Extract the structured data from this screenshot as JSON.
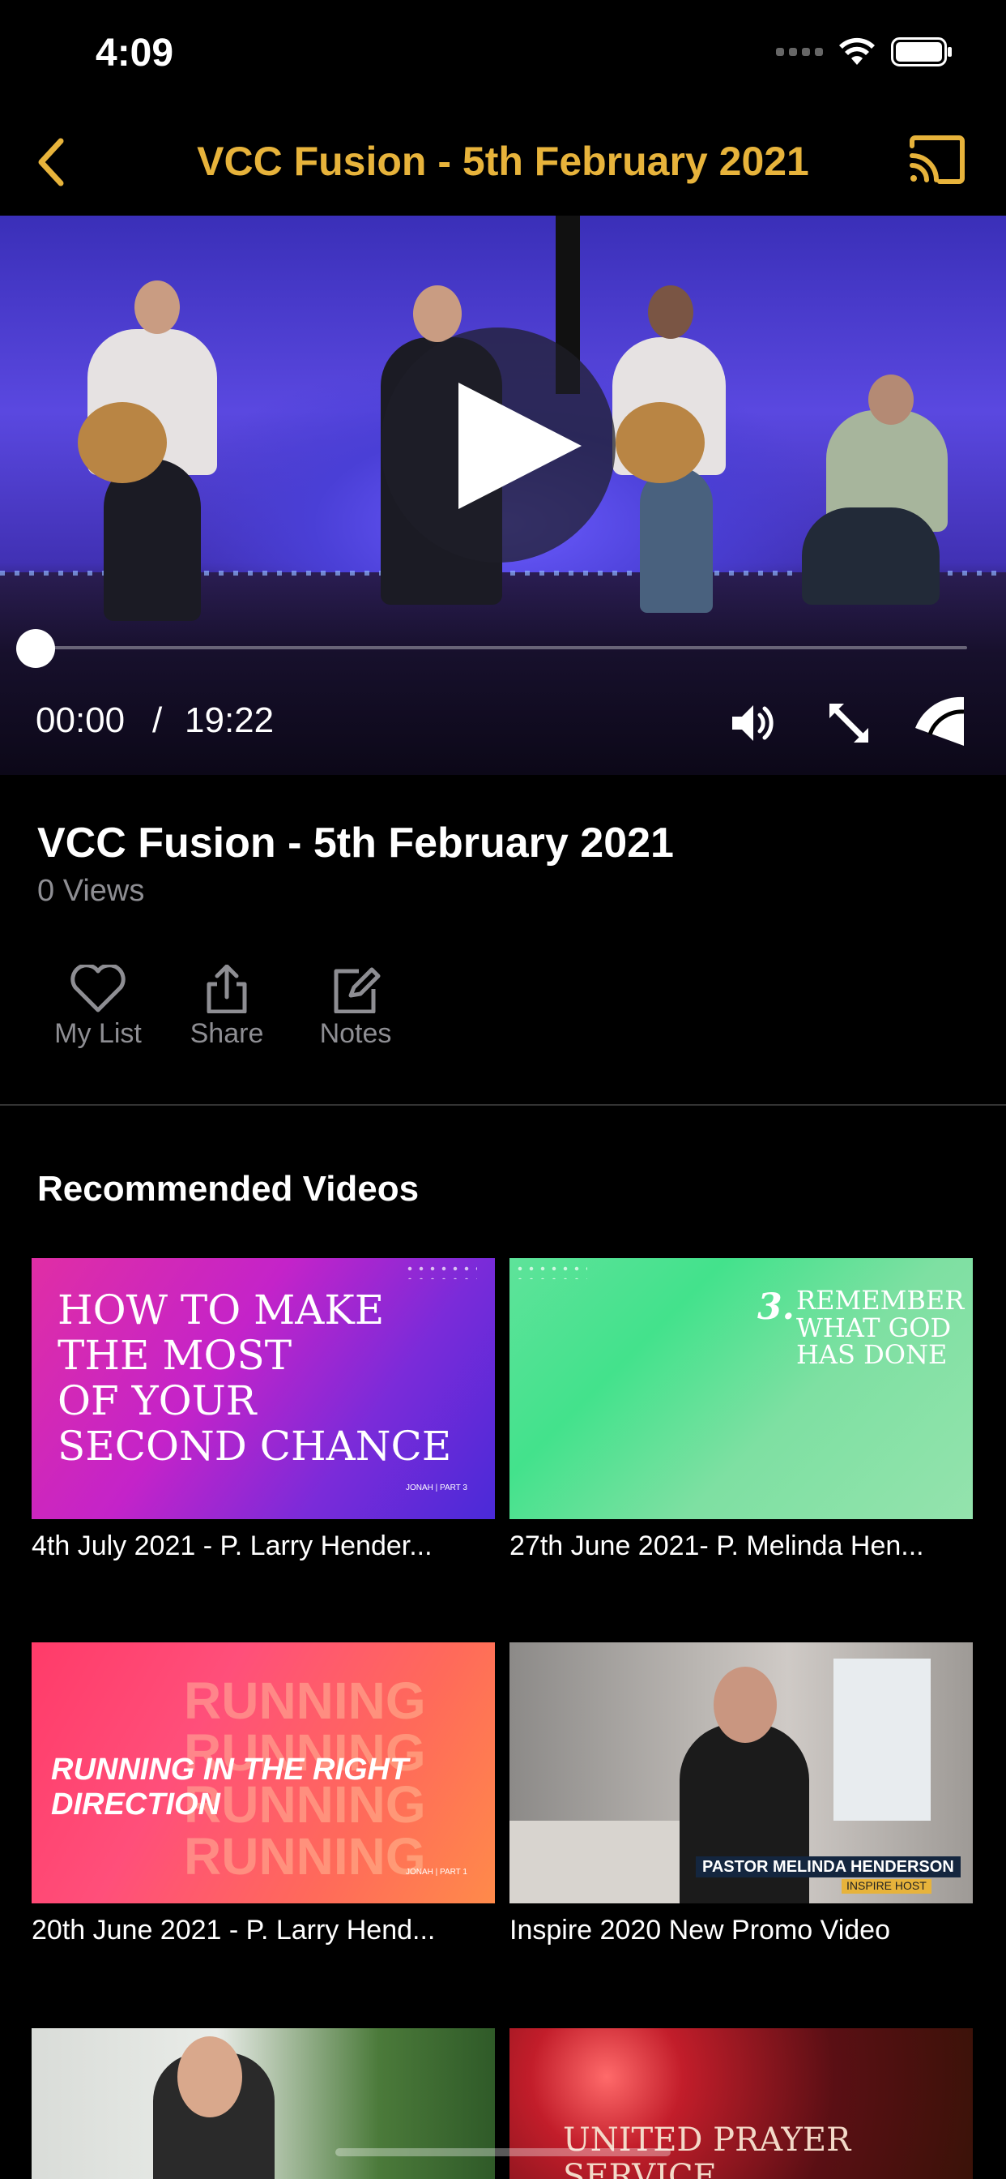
{
  "status_bar": {
    "time": "4:09"
  },
  "nav": {
    "title": "VCC Fusion - 5th February 2021"
  },
  "player": {
    "current_time": "00:00",
    "separator": "/",
    "total_time": "19:22",
    "progress": 0
  },
  "video": {
    "title": "VCC Fusion - 5th February 2021",
    "views": "0 Views"
  },
  "actions": [
    {
      "label": "My List",
      "icon": "heart-icon"
    },
    {
      "label": "Share",
      "icon": "share-icon"
    },
    {
      "label": "Notes",
      "icon": "notes-icon"
    }
  ],
  "recommended": {
    "heading": "Recommended Videos",
    "items": [
      {
        "caption": "4th July 2021 - P. Larry Hender...",
        "thumb_text": [
          "HOW TO MAKE",
          "THE MOST",
          "OF YOUR",
          "SECOND CHANCE"
        ],
        "thumb_tag": "JONAH | PART 3"
      },
      {
        "caption": "27th June 2021- P. Melinda Hen...",
        "thumb_number": "3.",
        "thumb_text": [
          "REMEMBER",
          "WHAT GOD",
          "HAS DONE"
        ]
      },
      {
        "caption": "20th June 2021 - P. Larry Hend...",
        "thumb_title": "RUNNING IN THE RIGHT DIRECTION",
        "thumb_bg_word": "RUNNING",
        "thumb_tag": "JONAH | PART 1"
      },
      {
        "caption": "Inspire 2020 New Promo Video",
        "thumb_name": "PASTOR MELINDA HENDERSON",
        "thumb_role": "INSPIRE HOST"
      },
      {
        "caption": ""
      },
      {
        "caption": "",
        "thumb_text": "UNITED PRAYER SERVICE"
      }
    ]
  },
  "colors": {
    "accent": "#e7b33b",
    "background": "#000000",
    "secondary_text": "#8e8e93"
  }
}
